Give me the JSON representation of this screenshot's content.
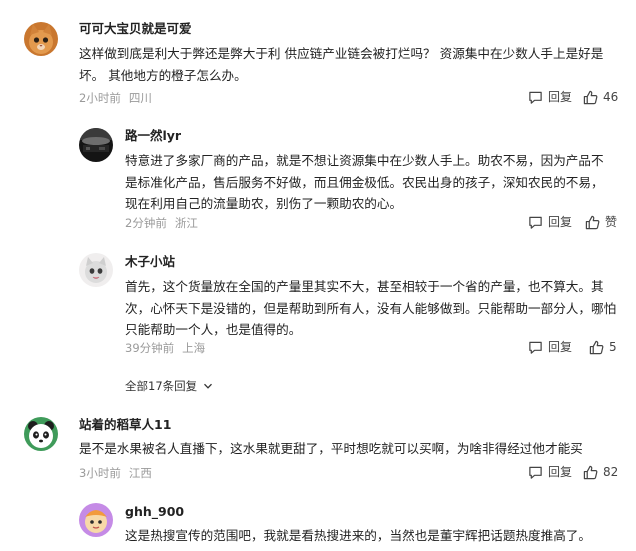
{
  "comments": [
    {
      "username": "可可大宝贝就是可爱",
      "text": "这样做到底是利大于弊还是弊大于利 供应链产业链会被打烂吗？ 资源集中在少数人手上是好是坏。 其他地方的橙子怎么办。",
      "time": "2小时前",
      "location": "四川",
      "reply_label": "回复",
      "like_count": "46"
    },
    {
      "username": "路一然lyr",
      "text": "特意进了多家厂商的产品，就是不想让资源集中在少数人手上。助农不易，因为产品不是标准化产品，售后服务不好做，而且佣金极低。农民出身的孩子，深知农民的不易，现在利用自己的流量助农，别伤了一颗助农的心。",
      "time": "2分钟前",
      "location": "浙江",
      "reply_label": "回复",
      "like_count": "赞"
    },
    {
      "username": "木子小站",
      "text": "首先，这个货量放在全国的产量里其实不大，甚至相较于一个省的产量，也不算大。其次，心怀天下是没错的，但是帮助到所有人，没有人能够做到。只能帮助一部分人，哪怕只能帮助一个人，也是值得的。",
      "time": "39分钟前",
      "location": "上海",
      "reply_label": "回复",
      "like_count": "5"
    },
    {
      "username": "站着的稻草人11",
      "text": "是不是水果被名人直播下，这水果就更甜了，平时想吃就可以买啊，为啥非得经过他才能买",
      "time": "3小时前",
      "location": "江西",
      "reply_label": "回复",
      "like_count": "82"
    },
    {
      "username": "ghh_900",
      "text": "这是热搜宣传的范围吧，我就是看热搜进来的，当然也是董宇辉把话题热度推高了。"
    }
  ],
  "expand_label": "全部17条回复",
  "colors": {
    "text": "#222222",
    "meta": "#9a9a9a",
    "action": "#444444"
  },
  "icons": {
    "reply": "comment-bubble-icon",
    "like": "thumbs-up-icon",
    "expand": "chevron-down-icon"
  }
}
